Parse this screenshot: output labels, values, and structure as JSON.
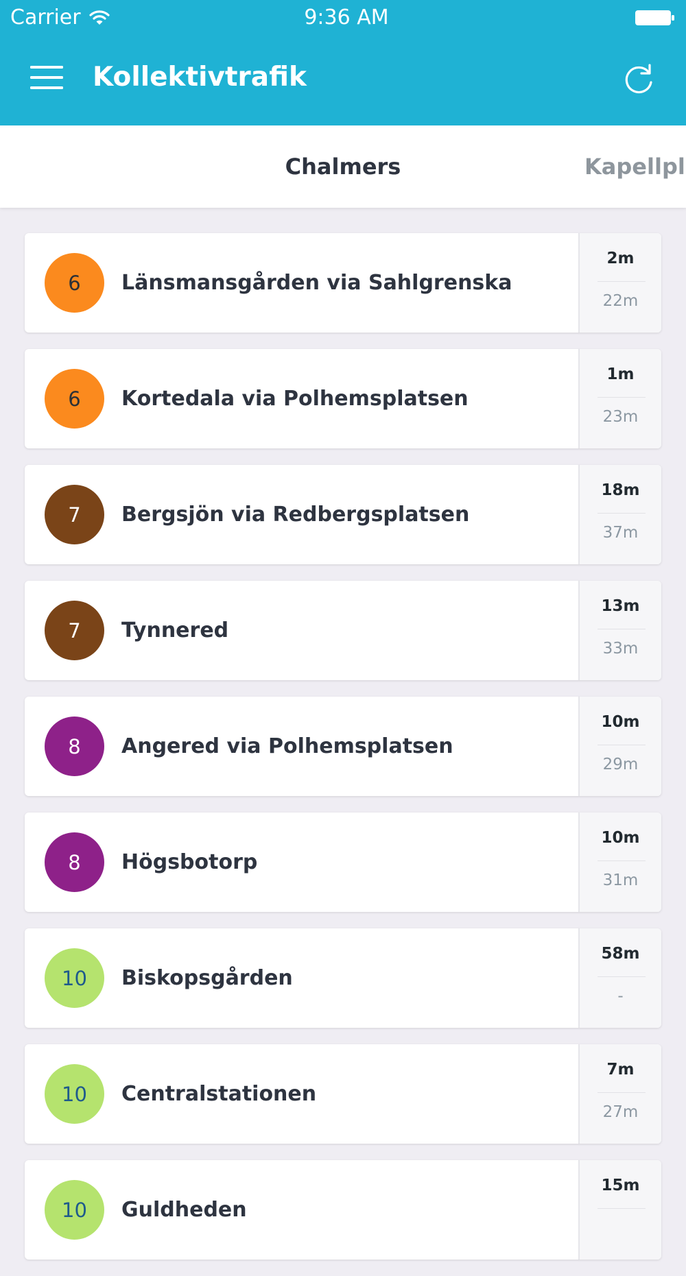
{
  "status_bar": {
    "carrier": "Carrier",
    "time": "9:36 AM"
  },
  "nav_bar": {
    "title": "Kollektivtrafik",
    "menu_icon": "hamburger-menu-icon",
    "refresh_icon": "refresh-icon"
  },
  "tabs": [
    {
      "label": "Chalmers",
      "active": true
    },
    {
      "label": "Kapellplat",
      "active": false
    }
  ],
  "departures": [
    {
      "line": "6",
      "badge_color": "#fb8a1e",
      "badge_text_color": "#2c3137",
      "destination": "Länsmansgården via Sahlgrenska",
      "next": "2m",
      "after": "22m"
    },
    {
      "line": "6",
      "badge_color": "#fb8a1e",
      "badge_text_color": "#2c3137",
      "destination": "Kortedala via Polhemsplatsen",
      "next": "1m",
      "after": "23m"
    },
    {
      "line": "7",
      "badge_color": "#7a4418",
      "badge_text_color": "#ffffff",
      "destination": "Bergsjön via Redbergsplatsen",
      "next": "18m",
      "after": "37m"
    },
    {
      "line": "7",
      "badge_color": "#7a4418",
      "badge_text_color": "#ffffff",
      "destination": "Tynnered",
      "next": "13m",
      "after": "33m"
    },
    {
      "line": "8",
      "badge_color": "#8e2189",
      "badge_text_color": "#ffffff",
      "destination": "Angered via Polhemsplatsen",
      "next": "10m",
      "after": "29m"
    },
    {
      "line": "8",
      "badge_color": "#8e2189",
      "badge_text_color": "#ffffff",
      "destination": "Högsbotorp",
      "next": "10m",
      "after": "31m"
    },
    {
      "line": "10",
      "badge_color": "#b5e36e",
      "badge_text_color": "#1e5a8c",
      "destination": "Biskopsgården",
      "next": "58m",
      "after": "-"
    },
    {
      "line": "10",
      "badge_color": "#b5e36e",
      "badge_text_color": "#1e5a8c",
      "destination": "Centralstationen",
      "next": "7m",
      "after": "27m"
    },
    {
      "line": "10",
      "badge_color": "#b5e36e",
      "badge_text_color": "#1e5a8c",
      "destination": "Guldheden",
      "next": "15m",
      "after": ""
    }
  ],
  "colors": {
    "nav_background": "#1fb2d4",
    "page_background": "#efedf3"
  }
}
